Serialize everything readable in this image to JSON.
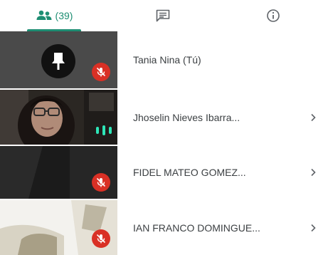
{
  "tabs": {
    "people": {
      "count": "(39)",
      "icon": "people-icon",
      "active": true,
      "accent": "#1e8e73"
    },
    "chat": {
      "icon": "chat-icon"
    },
    "info": {
      "icon": "info-icon"
    }
  },
  "participants": [
    {
      "name": "Tania Nina (Tú)",
      "muted": true,
      "has_chevron": false
    },
    {
      "name": "Jhoselin Nieves Ibarra...",
      "muted": false,
      "has_chevron": true
    },
    {
      "name": "FIDEL MATEO GOMEZ...",
      "muted": true,
      "has_chevron": true
    },
    {
      "name": "IAN FRANCO DOMINGUE...",
      "muted": true,
      "has_chevron": true
    }
  ],
  "colors": {
    "accent": "#1e8e73",
    "muted_badge": "#d93025",
    "speaking_indicator": "#2ee6b8"
  }
}
